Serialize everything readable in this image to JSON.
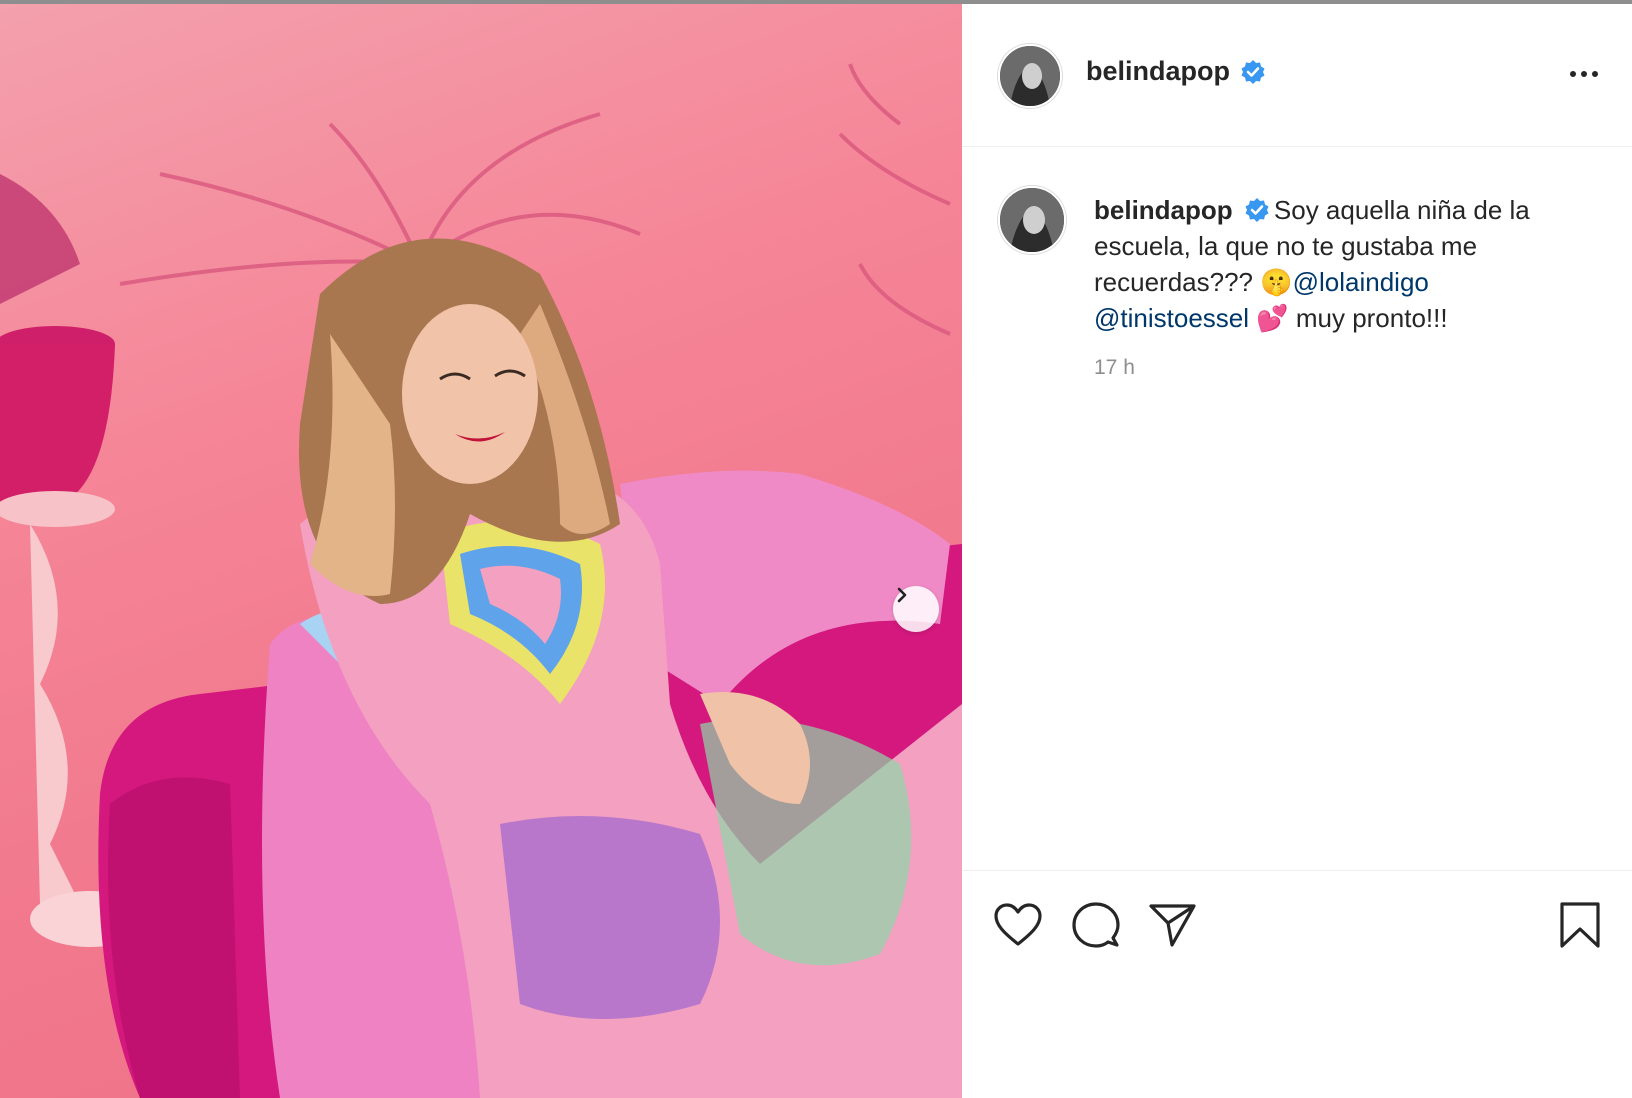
{
  "post": {
    "username": "belindapop",
    "verified": true,
    "caption_parts": {
      "text1": "Soy aquella niña de la escuela, la que no te gustaba me recuerdas??? ",
      "emoji1": "🤫",
      "mention1": "@lolaindigo",
      "mention2": "@tinistoessel",
      "emoji2": "💕",
      "text2": " muy pronto!!!"
    },
    "timestamp": "17 h"
  },
  "icons": {
    "verified": "verified-badge-icon",
    "more": "more-options-icon",
    "next": "chevron-right-icon",
    "like": "heart-icon",
    "comment": "comment-bubble-icon",
    "share": "paper-plane-icon",
    "save": "bookmark-icon"
  },
  "colors": {
    "verified_blue": "#3897f0",
    "mention_blue": "#00376b",
    "muted_gray": "#8e8e8e",
    "photo_pink": "#f27a8e"
  }
}
